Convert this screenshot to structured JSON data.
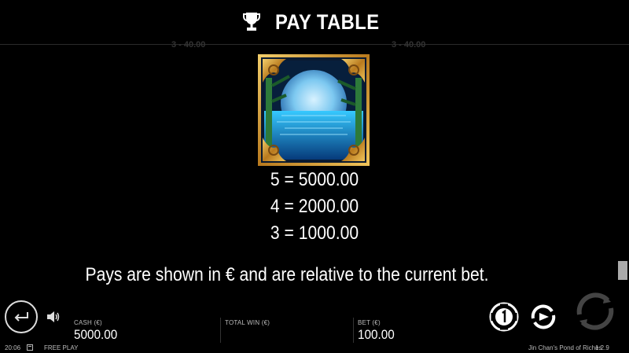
{
  "header": {
    "title": "PAY TABLE",
    "icon": "trophy-icon"
  },
  "ghost_row": {
    "left": "3 - 40.00",
    "right": "3 - 40.00"
  },
  "symbol": {
    "name": "moon-over-water-symbol"
  },
  "pays": [
    {
      "label": "5 = 5000.00"
    },
    {
      "label": "4 = 2000.00"
    },
    {
      "label": "3 = 1000.00"
    }
  ],
  "note": "Pays are shown in € and are relative to the current bet.",
  "bottom_bar": {
    "cash_label": "CASH (€)",
    "cash_value": "5000.00",
    "total_win_label": "TOTAL WIN (€)",
    "total_win_value": "",
    "bet_label": "BET (€)",
    "bet_value": "100.00"
  },
  "footer": {
    "time": "20:06",
    "mode": "FREE PLAY",
    "game_name": "Jin Chan's Pond of Riches",
    "version": "1.2.9"
  },
  "colors": {
    "gold": "#d9a23a",
    "water": "#1aa6e8",
    "background": "#000000"
  }
}
